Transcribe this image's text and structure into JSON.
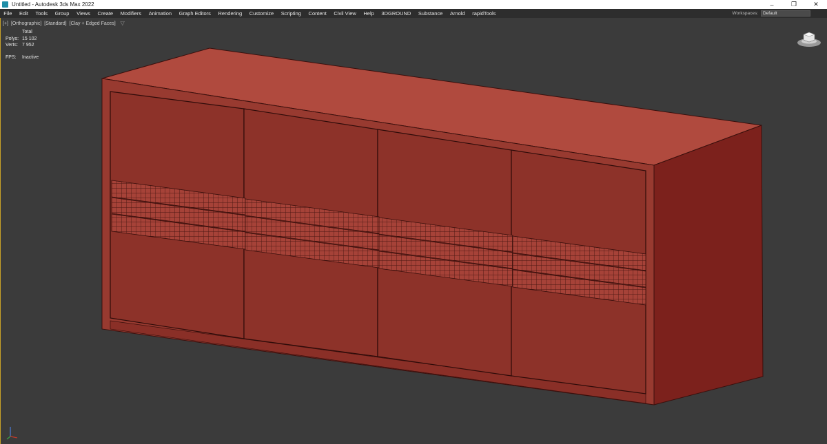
{
  "window": {
    "title": "Untitled - Autodesk 3ds Max 2022",
    "controls": [
      "–",
      "❐",
      "✕"
    ]
  },
  "menu": [
    "File",
    "Edit",
    "Tools",
    "Group",
    "Views",
    "Create",
    "Modifiers",
    "Animation",
    "Graph Editors",
    "Rendering",
    "Customize",
    "Scripting",
    "Content",
    "Civil View",
    "Help",
    "3DGROUND",
    "Substance",
    "Arnold",
    "rapidTools"
  ],
  "workspaces": {
    "label": "Workspaces:",
    "value": "Default"
  },
  "viewport": {
    "labels": [
      "[+]",
      "[Orthographic]",
      "[Standard]",
      "[Clay + Edged Faces]"
    ],
    "stats": {
      "header": "Total",
      "polys_label": "Polys:",
      "polys": "15 102",
      "verts_label": "Verts:",
      "verts": "7 952",
      "fps_label": "FPS:",
      "fps": "Inactive"
    },
    "clay_color": "#b4473c",
    "accent_border": "#c9a227"
  }
}
